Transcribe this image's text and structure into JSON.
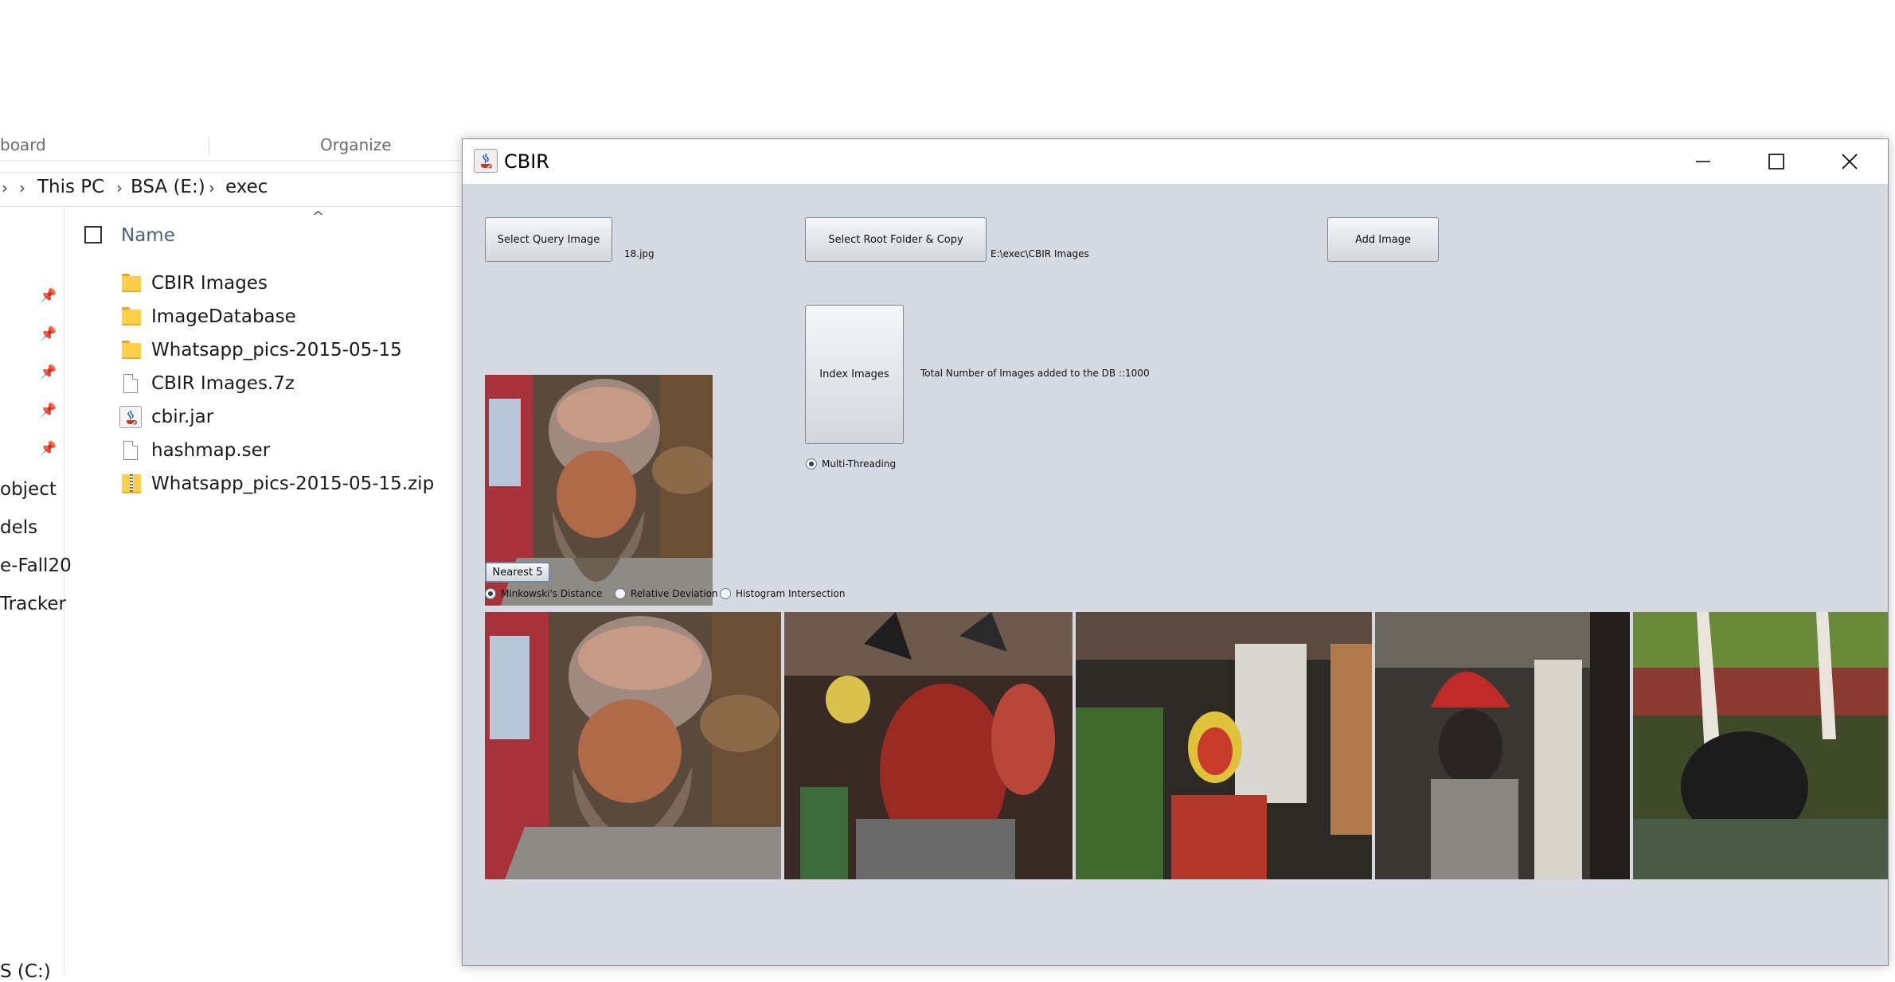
{
  "explorer": {
    "ribbon": {
      "clipboard_label": "board",
      "organize_label": "Organize"
    },
    "breadcrumb": [
      "This PC",
      "BSA (E:)",
      "exec"
    ],
    "column_header": "Name",
    "nav_items": [
      "object",
      "dels",
      "e-Fall20",
      "Tracker",
      "S (C:)"
    ],
    "files": [
      {
        "name": "CBIR Images",
        "icon": "folder-icon"
      },
      {
        "name": "ImageDatabase",
        "icon": "folder-icon"
      },
      {
        "name": "Whatsapp_pics-2015-05-15",
        "icon": "folder-icon"
      },
      {
        "name": "CBIR Images.7z",
        "icon": "file-icon"
      },
      {
        "name": "cbir.jar",
        "icon": "java-jar-icon"
      },
      {
        "name": "hashmap.ser",
        "icon": "file-icon"
      },
      {
        "name": "Whatsapp_pics-2015-05-15.zip",
        "icon": "zip-icon"
      }
    ]
  },
  "cbir": {
    "title": "CBIR",
    "buttons": {
      "select_query": "Select Query Image",
      "select_root": "Select Root Folder & Copy",
      "add_image": "Add Image",
      "index_images": "Index Images",
      "nearest": "Nearest 5"
    },
    "query_file_label": "18.jpg",
    "root_path_label": "E:\\exec\\CBIR Images",
    "total_label": "Total Number of Images added to the DB ::1000",
    "multithreading_label": "Multi-Threading",
    "multithreading_checked": true,
    "distance_options": [
      {
        "label": "Minkowski's Distance",
        "selected": true
      },
      {
        "label": "Relative Deviation",
        "selected": false
      },
      {
        "label": "Histogram Intersection",
        "selected": false
      }
    ],
    "colors": {
      "client_bg": "#d5d9e1",
      "button_border": "#7d8593"
    }
  }
}
